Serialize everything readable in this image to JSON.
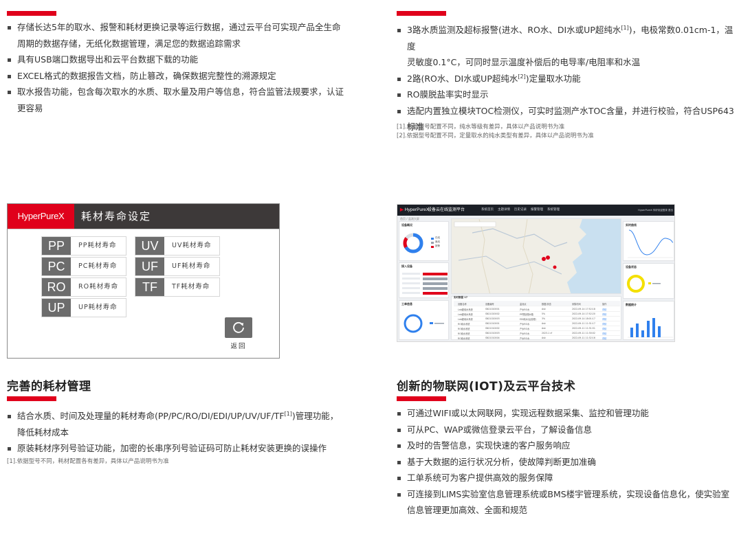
{
  "colors": {
    "accent": "#e0001b",
    "header_dark": "#3d3939",
    "code_gray": "#6c6c6c"
  },
  "data_mgmt": {
    "items": [
      {
        "lines": [
          "存储长达5年的取水、报警和耗材更换记录等运行数据，通过云平台可实现产品全生命",
          "周期的数据存储，无纸化数据管理，满足您的数据追踪需求"
        ]
      },
      {
        "lines": [
          "具有USB端口数据导出和云平台数据下载的功能"
        ]
      },
      {
        "lines": [
          "EXCEL格式的数据报告文档，防止篡改，确保数据完整性的溯源规定"
        ]
      },
      {
        "lines": [
          "取水报告功能，包含每次取水的水质、取水量及用户等信息，符合监管法规要求，认证",
          "更容易"
        ]
      }
    ]
  },
  "water_quality": {
    "item1_a": "3路水质监测及超标报警(进水、RO水、DI水或UP超纯水",
    "item1_sup": "[1]",
    "item1_b": ")，电极常数0.01cm-1，温度",
    "item1_line2": "灵敏度0.1°C，可同时显示温度补偿后的电导率/电阻率和水温",
    "item2_a": "2路(RO水、DI水或UP超纯水",
    "item2_sup": "[2]",
    "item2_b": ")定量取水功能",
    "item3": "RO膜脱盐率实时显示",
    "item4_line1": "选配内置独立模块TOC检测仪，可实时监测产水TOC含量，并进行校验，符合USP643",
    "item4_line2": "标准",
    "note1": "[1].依据型号配置不同，纯水等级有差异，具体以产品说明书为准",
    "note2": "[2].依据型号配置不同，定量取水的纯水类型有差异，具体以产品说明书为准"
  },
  "consumables_panel": {
    "logo": "HyperPureX",
    "title": "耗材寿命设定",
    "buttons": [
      {
        "code": "PP",
        "label": "PP耗材寿命"
      },
      {
        "code": "PC",
        "label": "PC耗材寿命"
      },
      {
        "code": "RO",
        "label": "RO耗材寿命"
      },
      {
        "code": "UP",
        "label": "UP耗材寿命"
      },
      {
        "code": "UV",
        "label": "UV耗材寿命"
      },
      {
        "code": "UF",
        "label": "UF耗材寿命"
      },
      {
        "code": "TF",
        "label": "TF耗材寿命"
      }
    ],
    "return_label": "返回"
  },
  "consumables": {
    "heading": "完善的耗材管理",
    "item1_a": "结合水质、时间及处理量的耗材寿命(PP/PC/RO/DI/EDI/UP/UV/UF/TF",
    "item1_sup": "[1]",
    "item1_b": ")管理功能，",
    "item1_line2": "降低耗材成本",
    "item2": "原装耗材序列号验证功能，加密的长串序列号验证码可防止耗材安装更换的误操作",
    "note": "[1].依据型号不同，耗材配置各有差异，具体以产品说明书为准"
  },
  "iot_dashboard": {
    "logo": "HyperPureX",
    "title": "设备云在线监测平台",
    "nav": [
      "系统首页",
      "主题详情",
      "历史记录",
      "报警管理",
      "系统管理"
    ],
    "user": "HyperPureX 你好欢迎登录 退出",
    "crumb": "首页 / 监测大屏",
    "device_overview": "设备概况",
    "device_list_title": "接入设备",
    "work_status": "工单信息",
    "alert_title": "报警统计",
    "trend_title": "实时曲线",
    "table_title": "实时数据 17",
    "status_title": "设备状态",
    "stat_title": "数据统计",
    "legend": [
      "在线",
      "离线",
      "报警"
    ],
    "table_headers": [
      "设备名称",
      "设备编号",
      "监测点",
      "数据/状态",
      "采集时间",
      "操作"
    ],
    "table_rows": [
      [
        "Lab超纯水系统",
        "SN21020001",
        "产水RO水",
        "Ask",
        "2022-09-14 17:52:18",
        "详情"
      ],
      [
        "Lab超纯水系统",
        "SN21020002",
        "PP预处理水箱",
        "5%",
        "2022-09-14 17:52:20",
        "详情"
      ],
      [
        "Lab超纯水系统",
        "SN21020003",
        "EDI纯水(后处理)",
        "3%",
        "2022-09-14 18:01:17",
        "详情"
      ],
      [
        "RO纯水系统",
        "SN21010001",
        "产水RO水",
        "Ask",
        "2022-09-11 11:31:17",
        "详情"
      ],
      [
        "RO纯水系统",
        "SN21010002",
        "产水RO水",
        "Ask",
        "2022-09-11 11:31:51",
        "详情"
      ],
      [
        "RO纯水系统",
        "SN21010003",
        "产水RO水",
        "2023-1 cf",
        "2022-09-11 11:30:02",
        "详情"
      ],
      [
        "RO纯水系统",
        "SN21010004",
        "产水RO水",
        "Ask",
        "2022-09-11 11:32:16",
        "详情"
      ]
    ]
  },
  "iot": {
    "heading": "创新的物联网(IOT)及云平台技术",
    "items": [
      "可通过WIFI或以太网联网，实现远程数据采集、监控和管理功能",
      "可从PC、WAP或微信登录云平台，了解设备信息",
      "及时的告警信息，实现快速的客户服务响应",
      "基于大数据的运行状况分析，使故障判断更加准确",
      "工单系统可为客户提供高效的服务保障"
    ],
    "item6_line1": "可连接到LIMS实验室信息管理系统或BMS楼宇管理系统，实现设备信息化，使实验室",
    "item6_line2": "信息管理更加高效、全面和规范"
  }
}
